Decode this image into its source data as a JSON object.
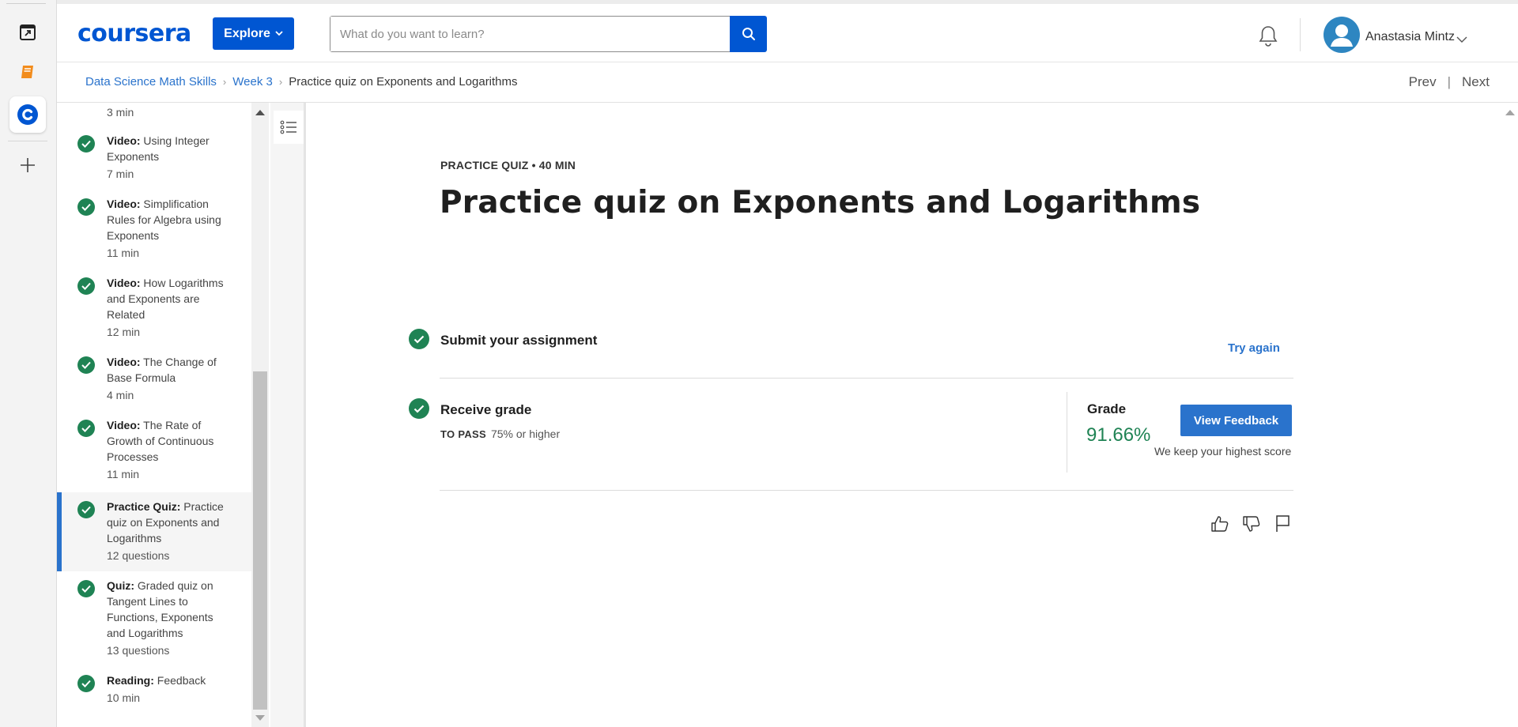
{
  "header": {
    "logo": "coursera",
    "explore_label": "Explore",
    "search_placeholder": "What do you want to learn?",
    "user_name": "Anastasia Mintz"
  },
  "breadcrumb": {
    "items": [
      "Data Science Math Skills",
      "Week 3"
    ],
    "current": "Practice quiz on Exponents and Logarithms",
    "prev": "Prev",
    "separator": "|",
    "next": "Next"
  },
  "sidebar": {
    "items": [
      {
        "type": "",
        "title": "",
        "meta": "3 min"
      },
      {
        "type": "Video:",
        "title": "Using Integer Exponents",
        "meta": "7 min"
      },
      {
        "type": "Video:",
        "title": "Simplification Rules for Algebra using Exponents",
        "meta": "11 min"
      },
      {
        "type": "Video:",
        "title": "How Logarithms and Exponents are Related",
        "meta": "12 min"
      },
      {
        "type": "Video:",
        "title": "The Change of Base Formula",
        "meta": "4 min"
      },
      {
        "type": "Video:",
        "title": "The Rate of Growth of Continuous Processes",
        "meta": "11 min"
      },
      {
        "type": "Practice Quiz:",
        "title": "Practice quiz on Exponents and Logarithms",
        "meta": "12 questions"
      },
      {
        "type": "Quiz:",
        "title": "Graded quiz on Tangent Lines to Functions, Exponents and Logarithms",
        "meta": "13 questions"
      },
      {
        "type": "Reading:",
        "title": "Feedback",
        "meta": "10 min"
      }
    ]
  },
  "main": {
    "kicker": "PRACTICE QUIZ • 40 MIN",
    "title": "Practice quiz on Exponents and Logarithms",
    "submit_label": "Submit your assignment",
    "try_again": "Try again",
    "receive_label": "Receive grade",
    "to_pass_label": "TO PASS",
    "to_pass_value": "75% or higher",
    "grade_label": "Grade",
    "grade_value": "91.66%",
    "view_feedback": "View Feedback",
    "keep_note": "We keep your highest score"
  },
  "colors": {
    "brand": "#0056d2",
    "link": "#2a73cc",
    "success": "#1f8354"
  }
}
